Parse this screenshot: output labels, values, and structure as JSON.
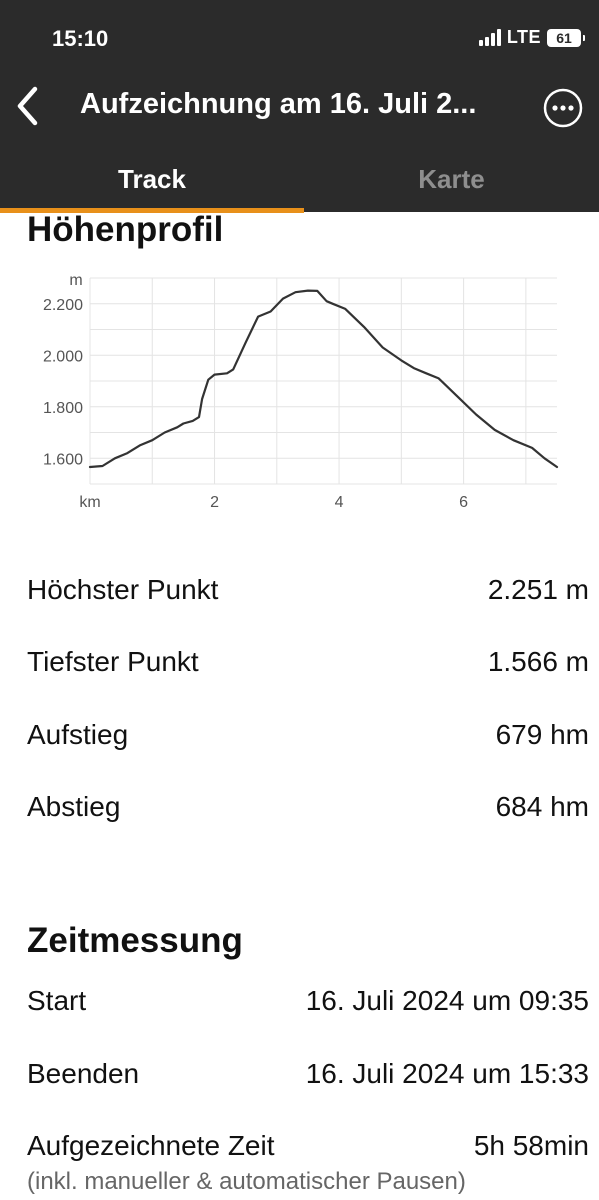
{
  "status_bar": {
    "time": "15:10",
    "network": "LTE",
    "battery": "61"
  },
  "header": {
    "title": "Aufzeichnung am 16. Juli 2...",
    "back_icon": "chevron-left-icon",
    "more_icon": "more-icon"
  },
  "tabs": [
    {
      "label": "Track",
      "selected": true
    },
    {
      "label": "Karte",
      "selected": false
    }
  ],
  "accent_color": "#e8901a",
  "elevation": {
    "title": "Höhenprofil"
  },
  "chart_data": {
    "type": "line",
    "ylabel": "m",
    "xlabel": "km",
    "x_ticks": [
      "2",
      "4",
      "6"
    ],
    "y_ticks": [
      "1.600",
      "1.800",
      "2.000",
      "2.200"
    ],
    "xlim": [
      0,
      7.5
    ],
    "ylim": [
      1500,
      2300
    ],
    "grid": true,
    "series": [
      {
        "x": [
          0,
          0.2,
          0.4,
          0.6,
          0.8,
          1.0,
          1.2,
          1.4,
          1.5,
          1.65,
          1.75,
          1.8,
          1.9,
          2.0,
          2.2,
          2.3,
          2.5,
          2.7,
          2.9,
          3.1,
          3.3,
          3.5,
          3.65,
          3.8,
          3.9,
          4.1,
          4.4,
          4.7,
          5.0,
          5.2,
          5.4,
          5.6,
          5.9,
          6.2,
          6.5,
          6.8,
          7.1,
          7.3,
          7.5
        ],
        "y": [
          1566,
          1570,
          1600,
          1620,
          1650,
          1670,
          1700,
          1720,
          1735,
          1745,
          1760,
          1830,
          1905,
          1925,
          1930,
          1945,
          2050,
          2150,
          2170,
          2220,
          2245,
          2251,
          2250,
          2210,
          2200,
          2180,
          2110,
          2030,
          1980,
          1950,
          1930,
          1910,
          1840,
          1770,
          1710,
          1670,
          1640,
          1600,
          1566
        ]
      }
    ]
  },
  "stats": [
    {
      "label": "Höchster Punkt",
      "value": "2.251 m"
    },
    {
      "label": "Tiefster Punkt",
      "value": "1.566 m"
    },
    {
      "label": "Aufstieg",
      "value": "679 hm"
    },
    {
      "label": "Abstieg",
      "value": "684 hm"
    }
  ],
  "time": {
    "title": "Zeitmessung",
    "start": {
      "label": "Start",
      "value": "16. Juli 2024 um 09:35"
    },
    "end": {
      "label": "Beenden",
      "value": "16. Juli 2024 um 15:33"
    },
    "recorded": {
      "label": "Aufgezeichnete Zeit",
      "value": "5h 58min",
      "note": "(inkl. manueller & automatischer Pausen)"
    }
  }
}
